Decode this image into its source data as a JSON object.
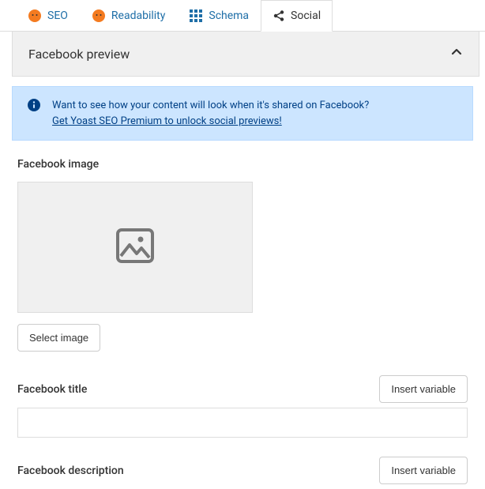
{
  "tabs": {
    "seo": "SEO",
    "readability": "Readability",
    "schema": "Schema",
    "social": "Social"
  },
  "panel": {
    "title": "Facebook preview"
  },
  "notice": {
    "text": "Want to see how your content will look when it's shared on Facebook?",
    "link": "Get Yoast SEO Premium to unlock social previews!"
  },
  "labels": {
    "facebook_image": "Facebook image",
    "select_image": "Select image",
    "facebook_title": "Facebook title",
    "facebook_description": "Facebook description",
    "insert_variable": "Insert variable"
  },
  "fields": {
    "title_value": "",
    "description_value": ""
  }
}
